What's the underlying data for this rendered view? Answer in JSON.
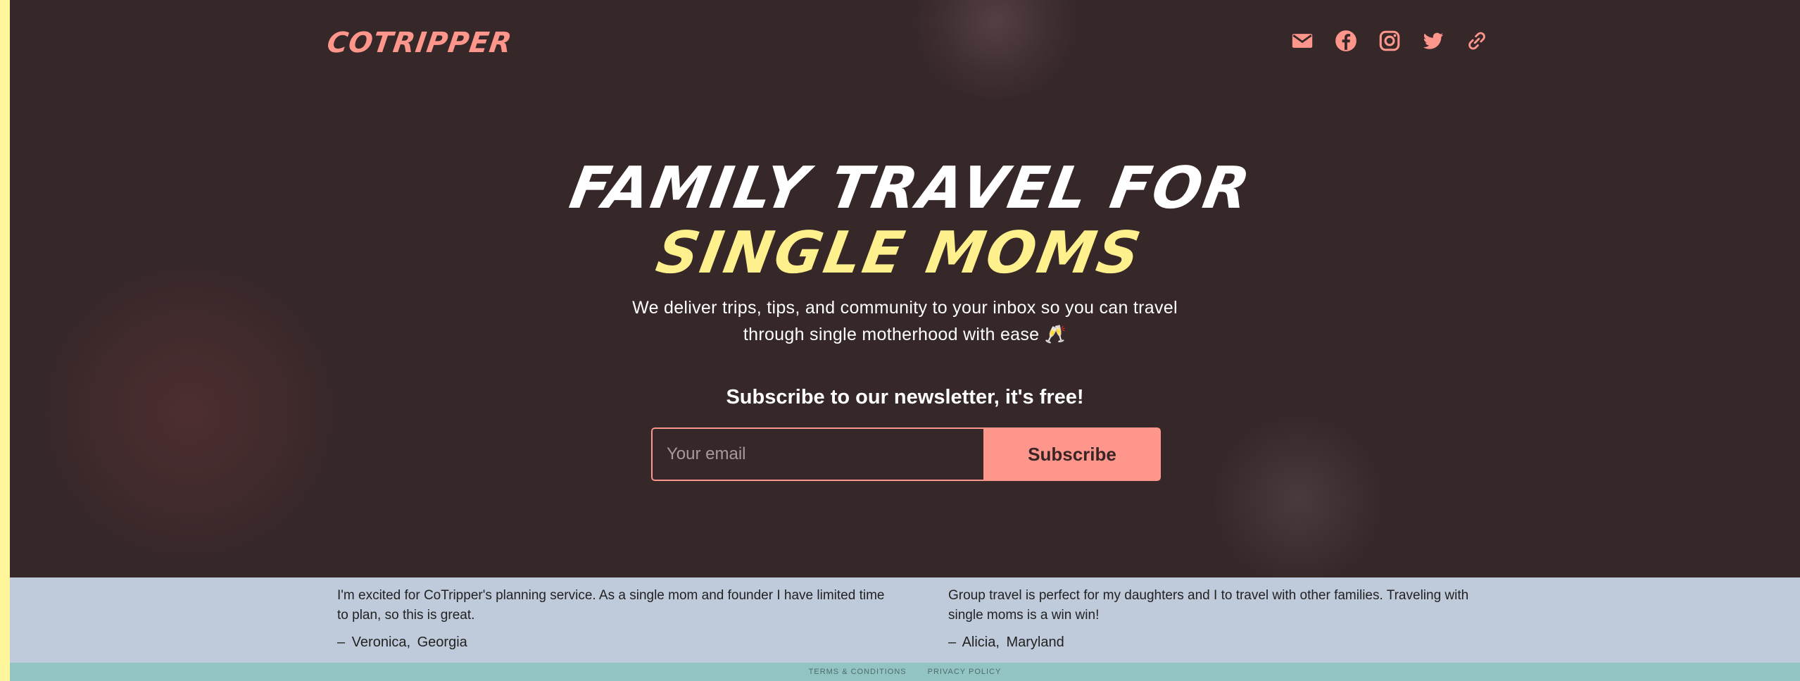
{
  "brand": {
    "logo_text": "COTRIPPER",
    "accent_color": "#ff968c",
    "highlight_color": "#fff08e",
    "background_color": "#362729"
  },
  "header": {
    "social_icons": [
      "email-icon",
      "facebook-icon",
      "instagram-icon",
      "twitter-icon",
      "link-icon"
    ]
  },
  "hero": {
    "headline_line1": "FAMILY TRAVEL FOR",
    "headline_line2": "SINGLE MOMS",
    "tagline_line1": "We deliver trips, tips, and community to your inbox so you can travel",
    "tagline_line2": "through single motherhood with ease 🥂"
  },
  "newsletter": {
    "title": "Subscribe to our newsletter, it's free!",
    "email_placeholder": "Your email",
    "button_label": "Subscribe"
  },
  "testimonials": [
    {
      "quote": "I'm excited for CoTripper's planning service. As a single mom and founder I have limited time to plan, so this is great.",
      "author": "– Veronica, Georgia"
    },
    {
      "quote": "Group travel is perfect for my daughters and I to travel with other families. Traveling with single moms is a win win!",
      "author": "– Alicia, Maryland"
    }
  ],
  "footer": {
    "terms_label": "TERMS & CONDITIONS",
    "privacy_label": "PRIVACY POLICY"
  }
}
